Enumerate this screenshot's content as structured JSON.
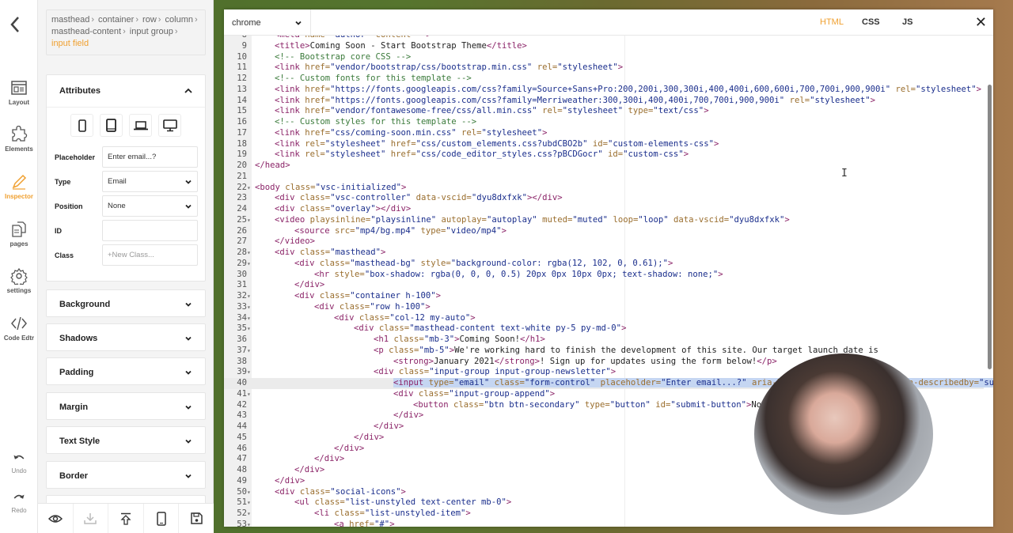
{
  "rail": {
    "back_label": "<",
    "items": [
      {
        "label": "Layout",
        "icon": "layout-icon",
        "active": false
      },
      {
        "label": "Elements",
        "icon": "puzzle-icon",
        "active": false
      },
      {
        "label": "Inspector",
        "icon": "pencil-icon",
        "active": true
      },
      {
        "label": "pages",
        "icon": "pages-icon",
        "active": false
      },
      {
        "label": "settings",
        "icon": "gear-icon",
        "active": false
      },
      {
        "label": "Code Edtr",
        "icon": "code-icon",
        "active": false
      }
    ],
    "undo_label": "Undo",
    "redo_label": "Redo"
  },
  "breadcrumb": {
    "items": [
      "masthead",
      "container",
      "row",
      "column",
      "masthead-content",
      "input group"
    ],
    "current": "input field"
  },
  "attributes": {
    "title": "Attributes",
    "devices": [
      "mobile-icon",
      "tablet-icon",
      "laptop-icon",
      "desktop-icon"
    ],
    "placeholder_label": "Placeholder",
    "placeholder_value": "Enter email...?",
    "type_label": "Type",
    "type_value": "Email",
    "position_label": "Position",
    "position_value": "None",
    "id_label": "ID",
    "id_value": "",
    "class_label": "Class",
    "class_placeholder": "+New Class..."
  },
  "sections": [
    "Background",
    "Shadows",
    "Padding",
    "Margin",
    "Text Style",
    "Border"
  ],
  "bottom_bar": [
    "eye-icon",
    "download-icon",
    "upload-icon",
    "mobile-preview-icon",
    "save-icon"
  ],
  "editor": {
    "browser": "chrome",
    "tabs": [
      "HTML",
      "CSS",
      "JS"
    ],
    "active_tab": "HTML",
    "close_label": "✕",
    "lines": [
      {
        "n": "8",
        "fold": "",
        "indent": 1,
        "html": "<span class='t-tag'>&lt;meta</span> <span class='t-attr'>name=</span><span class='t-str'>\"author\"</span> <span class='t-attr'>content=</span><span class='t-str'>\"\"</span><span class='t-tag'>&gt;</span>"
      },
      {
        "n": "9",
        "fold": "",
        "indent": 1,
        "html": "<span class='t-tag'>&lt;title&gt;</span>Coming Soon - Start Bootstrap Theme<span class='t-tag'>&lt;/title&gt;</span>"
      },
      {
        "n": "10",
        "fold": "",
        "indent": 1,
        "html": "<span class='t-cmt'>&lt;!-- Bootstrap core CSS --&gt;</span>"
      },
      {
        "n": "11",
        "fold": "",
        "indent": 1,
        "html": "<span class='t-tag'>&lt;link</span> <span class='t-attr'>href=</span><span class='t-str'>\"vendor/bootstrap/css/bootstrap.min.css\"</span> <span class='t-attr'>rel=</span><span class='t-str'>\"stylesheet\"</span><span class='t-tag'>&gt;</span>"
      },
      {
        "n": "12",
        "fold": "",
        "indent": 1,
        "html": "<span class='t-cmt'>&lt;!-- Custom fonts for this template --&gt;</span>"
      },
      {
        "n": "13",
        "fold": "",
        "indent": 1,
        "html": "<span class='t-tag'>&lt;link</span> <span class='t-attr'>href=</span><span class='t-str'>\"https://fonts.googleapis.com/css?family=Source+Sans+Pro:200,200i,300,300i,400,400i,600,600i,700,700i,900,900i\"</span> <span class='t-attr'>rel=</span><span class='t-str'>\"stylesheet\"</span><span class='t-tag'>&gt;</span>"
      },
      {
        "n": "14",
        "fold": "",
        "indent": 1,
        "html": "<span class='t-tag'>&lt;link</span> <span class='t-attr'>href=</span><span class='t-str'>\"https://fonts.googleapis.com/css?family=Merriweather:300,300i,400,400i,700,700i,900,900i\"</span> <span class='t-attr'>rel=</span><span class='t-str'>\"stylesheet\"</span><span class='t-tag'>&gt;</span>"
      },
      {
        "n": "15",
        "fold": "",
        "indent": 1,
        "html": "<span class='t-tag'>&lt;link</span> <span class='t-attr'>href=</span><span class='t-str'>\"vendor/fontawesome-free/css/all.min.css\"</span> <span class='t-attr'>rel=</span><span class='t-str'>\"stylesheet\"</span> <span class='t-attr'>type=</span><span class='t-str'>\"text/css\"</span><span class='t-tag'>&gt;</span>"
      },
      {
        "n": "16",
        "fold": "",
        "indent": 1,
        "html": "<span class='t-cmt'>&lt;!-- Custom styles for this template --&gt;</span>"
      },
      {
        "n": "17",
        "fold": "",
        "indent": 1,
        "html": "<span class='t-tag'>&lt;link</span> <span class='t-attr'>href=</span><span class='t-str'>\"css/coming-soon.min.css\"</span> <span class='t-attr'>rel=</span><span class='t-str'>\"stylesheet\"</span><span class='t-tag'>&gt;</span>"
      },
      {
        "n": "18",
        "fold": "",
        "indent": 1,
        "html": "<span class='t-tag'>&lt;link</span> <span class='t-attr'>rel=</span><span class='t-str'>\"stylesheet\"</span> <span class='t-attr'>href=</span><span class='t-str'>\"css/custom_elements.css?ubdCBO2b\"</span> <span class='t-attr'>id=</span><span class='t-str'>\"custom-elements-css\"</span><span class='t-tag'>&gt;</span>"
      },
      {
        "n": "19",
        "fold": "",
        "indent": 1,
        "html": "<span class='t-tag'>&lt;link</span> <span class='t-attr'>rel=</span><span class='t-str'>\"stylesheet\"</span> <span class='t-attr'>href=</span><span class='t-str'>\"css/code_editor_styles.css?pBCDGocr\"</span> <span class='t-attr'>id=</span><span class='t-str'>\"custom-css\"</span><span class='t-tag'>&gt;</span>"
      },
      {
        "n": "20",
        "fold": "",
        "indent": 0,
        "html": "<span class='t-tag'>&lt;/head&gt;</span>"
      },
      {
        "n": "21",
        "fold": "",
        "indent": 0,
        "html": ""
      },
      {
        "n": "22",
        "fold": "-",
        "indent": 0,
        "html": "<span class='t-tag'>&lt;body</span> <span class='t-attr'>class=</span><span class='t-str'>\"vsc-initialized\"</span><span class='t-tag'>&gt;</span>"
      },
      {
        "n": "23",
        "fold": "",
        "indent": 1,
        "html": "<span class='t-tag'>&lt;div</span> <span class='t-attr'>class=</span><span class='t-str'>\"vsc-controller\"</span> <span class='t-attr'>data-vscid=</span><span class='t-str'>\"dyu8dxfxk\"</span><span class='t-tag'>&gt;&lt;/div&gt;</span>"
      },
      {
        "n": "24",
        "fold": "",
        "indent": 1,
        "html": "<span class='t-tag'>&lt;div</span> <span class='t-attr'>class=</span><span class='t-str'>\"overlay\"</span><span class='t-tag'>&gt;&lt;/div&gt;</span>"
      },
      {
        "n": "25",
        "fold": "-",
        "indent": 1,
        "html": "<span class='t-tag'>&lt;video</span> <span class='t-attr'>playsinline=</span><span class='t-str'>\"playsinline\"</span> <span class='t-attr'>autoplay=</span><span class='t-str'>\"autoplay\"</span> <span class='t-attr'>muted=</span><span class='t-str'>\"muted\"</span> <span class='t-attr'>loop=</span><span class='t-str'>\"loop\"</span> <span class='t-attr'>data-vscid=</span><span class='t-str'>\"dyu8dxfxk\"</span><span class='t-tag'>&gt;</span>"
      },
      {
        "n": "26",
        "fold": "",
        "indent": 2,
        "html": "<span class='t-tag'>&lt;source</span> <span class='t-attr'>src=</span><span class='t-str'>\"mp4/bg.mp4\"</span> <span class='t-attr'>type=</span><span class='t-str'>\"video/mp4\"</span><span class='t-tag'>&gt;</span>"
      },
      {
        "n": "27",
        "fold": "",
        "indent": 1,
        "html": "<span class='t-tag'>&lt;/video&gt;</span>"
      },
      {
        "n": "28",
        "fold": "-",
        "indent": 1,
        "html": "<span class='t-tag'>&lt;div</span> <span class='t-attr'>class=</span><span class='t-str'>\"masthead\"</span><span class='t-tag'>&gt;</span>"
      },
      {
        "n": "29",
        "fold": "-",
        "indent": 2,
        "html": "<span class='t-tag'>&lt;div</span> <span class='t-attr'>class=</span><span class='t-str'>\"masthead-bg\"</span> <span class='t-attr'>style=</span><span class='t-str'>\"background-color: rgba(12, 102, 0, 0.61);\"</span><span class='t-tag'>&gt;</span>"
      },
      {
        "n": "30",
        "fold": "",
        "indent": 3,
        "html": "<span class='t-tag'>&lt;hr</span> <span class='t-attr'>style=</span><span class='t-str'>\"box-shadow: rgba(0, 0, 0, 0.5) 20px 0px 10px 0px; text-shadow: none;\"</span><span class='t-tag'>&gt;</span>"
      },
      {
        "n": "31",
        "fold": "",
        "indent": 2,
        "html": "<span class='t-tag'>&lt;/div&gt;</span>"
      },
      {
        "n": "32",
        "fold": "-",
        "indent": 2,
        "html": "<span class='t-tag'>&lt;div</span> <span class='t-attr'>class=</span><span class='t-str'>\"container h-100\"</span><span class='t-tag'>&gt;</span>"
      },
      {
        "n": "33",
        "fold": "-",
        "indent": 3,
        "html": "<span class='t-tag'>&lt;div</span> <span class='t-attr'>class=</span><span class='t-str'>\"row h-100\"</span><span class='t-tag'>&gt;</span>"
      },
      {
        "n": "34",
        "fold": "-",
        "indent": 4,
        "html": "<span class='t-tag'>&lt;div</span> <span class='t-attr'>class=</span><span class='t-str'>\"col-12 my-auto\"</span><span class='t-tag'>&gt;</span>"
      },
      {
        "n": "35",
        "fold": "-",
        "indent": 5,
        "html": "<span class='t-tag'>&lt;div</span> <span class='t-attr'>class=</span><span class='t-str'>\"masthead-content text-white py-5 py-md-0\"</span><span class='t-tag'>&gt;</span>"
      },
      {
        "n": "36",
        "fold": "",
        "indent": 6,
        "html": "<span class='t-tag'>&lt;h1</span> <span class='t-attr'>class=</span><span class='t-str'>\"mb-3\"</span><span class='t-tag'>&gt;</span>Coming Soon!<span class='t-tag'>&lt;/h1&gt;</span>"
      },
      {
        "n": "37",
        "fold": "-",
        "indent": 6,
        "html": "<span class='t-tag'>&lt;p</span> <span class='t-attr'>class=</span><span class='t-str'>\"mb-5\"</span><span class='t-tag'>&gt;</span>We're working hard to finish the development of this site. Our target launch date is"
      },
      {
        "n": "38",
        "fold": "",
        "indent": 7,
        "html": "<span class='t-tag'>&lt;strong&gt;</span>January 2021<span class='t-tag'>&lt;/strong&gt;</span>! Sign up for updates using the form below!<span class='t-tag'>&lt;/p&gt;</span>"
      },
      {
        "n": "39",
        "fold": "-",
        "indent": 6,
        "html": "<span class='t-tag'>&lt;div</span> <span class='t-attr'>class=</span><span class='t-str'>\"input-group input-group-newsletter\"</span><span class='t-tag'>&gt;</span>"
      },
      {
        "n": "40",
        "fold": "",
        "indent": 7,
        "hl": true,
        "html": "<span class='sel'><span class='t-tag'>&lt;input</span> <span class='t-attr'>type=</span><span class='t-str'>\"email\"</span> <span class='t-attr'>class=</span><span class='t-str'>\"form-control\"</span> <span class='t-attr'>placeholder=</span><span class='t-str'>\"Enter email...?\"</span> <span class='t-attr'>aria-label=</span><span class='t-str'>\"Enter email...\"</span> <span class='t-attr'>aria-describedby=</span><span class='t-str'>\"submit-button\"</span><span class='t-tag'>&gt;</span></span>"
      },
      {
        "n": "41",
        "fold": "-",
        "indent": 7,
        "html": "<span class='t-tag'>&lt;div</span> <span class='t-attr'>class=</span><span class='t-str'>\"input-group-append\"</span><span class='t-tag'>&gt;</span>"
      },
      {
        "n": "42",
        "fold": "",
        "indent": 8,
        "html": "<span class='t-tag'>&lt;button</span> <span class='t-attr'>class=</span><span class='t-str'>\"btn btn-secondary\"</span> <span class='t-attr'>type=</span><span class='t-str'>\"button\"</span> <span class='t-attr'>id=</span><span class='t-str'>\"submit-button\"</span><span class='t-tag'>&gt;</span>Notify Me!<span class='t-tag'>&lt;/button&gt;</span>"
      },
      {
        "n": "43",
        "fold": "",
        "indent": 7,
        "html": "<span class='t-tag'>&lt;/div&gt;</span>"
      },
      {
        "n": "44",
        "fold": "",
        "indent": 6,
        "html": "<span class='t-tag'>&lt;/div&gt;</span>"
      },
      {
        "n": "45",
        "fold": "",
        "indent": 5,
        "html": "<span class='t-tag'>&lt;/div&gt;</span>"
      },
      {
        "n": "46",
        "fold": "",
        "indent": 4,
        "html": "<span class='t-tag'>&lt;/div&gt;</span>"
      },
      {
        "n": "47",
        "fold": "",
        "indent": 3,
        "html": "<span class='t-tag'>&lt;/div&gt;</span>"
      },
      {
        "n": "48",
        "fold": "",
        "indent": 2,
        "html": "<span class='t-tag'>&lt;/div&gt;</span>"
      },
      {
        "n": "49",
        "fold": "",
        "indent": 1,
        "html": "<span class='t-tag'>&lt;/div&gt;</span>"
      },
      {
        "n": "50",
        "fold": "-",
        "indent": 1,
        "html": "<span class='t-tag'>&lt;div</span> <span class='t-attr'>class=</span><span class='t-str'>\"social-icons\"</span><span class='t-tag'>&gt;</span>"
      },
      {
        "n": "51",
        "fold": "-",
        "indent": 2,
        "html": "<span class='t-tag'>&lt;ul</span> <span class='t-attr'>class=</span><span class='t-str'>\"list-unstyled text-center mb-0\"</span><span class='t-tag'>&gt;</span>"
      },
      {
        "n": "52",
        "fold": "-",
        "indent": 3,
        "html": "<span class='t-tag'>&lt;li</span> <span class='t-attr'>class=</span><span class='t-str'>\"list-unstyled-item\"</span><span class='t-tag'>&gt;</span>"
      },
      {
        "n": "53",
        "fold": "-",
        "indent": 4,
        "html": "<span class='t-tag'>&lt;a</span> <span class='t-attr'>href=</span><span class='t-str'>\"#\"</span><span class='t-tag'>&gt;</span>"
      }
    ]
  }
}
